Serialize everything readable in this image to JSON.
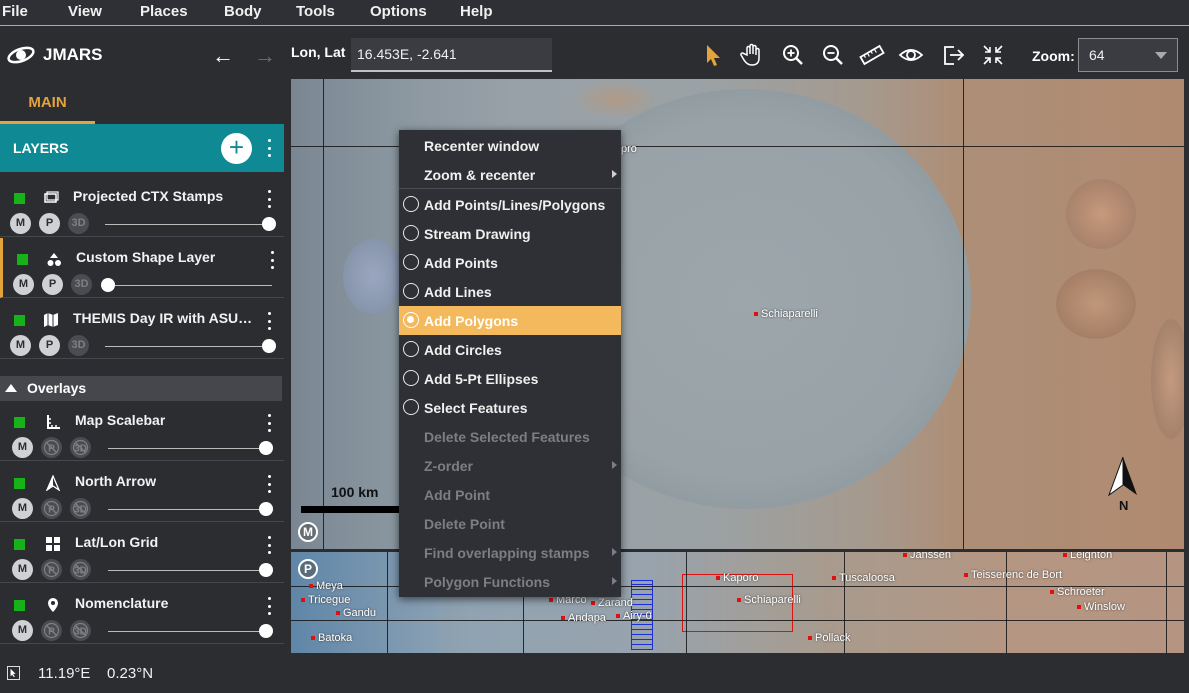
{
  "menubar": [
    "File",
    "View",
    "Places",
    "Body",
    "Tools",
    "Options",
    "Help"
  ],
  "toolbar": {
    "app_name": "JMARS",
    "lonlat_label": "Lon, Lat",
    "lonlat_value": "16.453E, -2.641",
    "zoom_label": "Zoom:",
    "zoom_value": "64",
    "tools": [
      "select-arrow-icon",
      "pan-hand-icon",
      "zoom-in-icon",
      "zoom-out-icon",
      "measure-ruler-icon",
      "view-eye-icon",
      "export-icon",
      "fit-extent-icon"
    ],
    "accent_color": "#e4a33b"
  },
  "left_panel": {
    "tab": "MAIN",
    "layers_title": "LAYERS",
    "layers": [
      {
        "name": "Projected CTX Stamps",
        "icon": "stamp-icon",
        "visible": true,
        "opacity": 1.0,
        "selected": false,
        "mpb": [
          "M",
          "P",
          "3D"
        ]
      },
      {
        "name": "Custom Shape Layer",
        "icon": "shapes-icon",
        "visible": true,
        "opacity": 0.0,
        "selected": true,
        "mpb": [
          "M",
          "P",
          "3D"
        ]
      },
      {
        "name": "THEMIS Day IR with ASU Con...",
        "icon": "map-icon",
        "visible": true,
        "opacity": 1.0,
        "selected": false,
        "mpb": [
          "M",
          "P",
          "3D"
        ]
      }
    ],
    "overlays_title": "Overlays",
    "overlays": [
      {
        "name": "Map Scalebar",
        "icon": "scalebar-icon",
        "visible": true,
        "opacity": 1.0
      },
      {
        "name": "North Arrow",
        "icon": "north-arrow-icon",
        "visible": true,
        "opacity": 1.0
      },
      {
        "name": "Lat/Lon Grid",
        "icon": "grid-icon",
        "visible": true,
        "opacity": 1.0
      },
      {
        "name": "Nomenclature",
        "icon": "pin-icon",
        "visible": true,
        "opacity": 1.0
      }
    ],
    "toggle_labels": {
      "m": "M",
      "p": "P",
      "d": "3D"
    },
    "visible_color": "#17b21a",
    "header_color": "#0f8a95"
  },
  "map": {
    "scalebar_label": "100 km",
    "north_label": "N",
    "badge_main": "M",
    "badge_panner": "P",
    "labels_main": [
      "Schiaparelli",
      "pro"
    ],
    "labels_panner": [
      "Janssen",
      "Leighton",
      "Kaporo",
      "Tuscaloosa",
      "Teisserenc de Bort",
      "Schiaparelli",
      "Schroeter",
      "Winslow",
      "Pollack",
      "Batoka",
      "Marco",
      "Zarand",
      "Andapa",
      "Airy-0",
      "Meya",
      "Tricegue",
      "Gandu"
    ]
  },
  "context_menu": {
    "items": [
      {
        "label": "Recenter window",
        "type": "plain",
        "submenu": false,
        "enabled": true
      },
      {
        "label": "Zoom & recenter",
        "type": "plain",
        "submenu": true,
        "enabled": true
      },
      {
        "label": "Add Points/Lines/Polygons",
        "type": "radio",
        "submenu": false,
        "enabled": true
      },
      {
        "label": "Stream Drawing",
        "type": "radio",
        "submenu": false,
        "enabled": true
      },
      {
        "label": "Add Points",
        "type": "radio",
        "submenu": false,
        "enabled": true
      },
      {
        "label": "Add Lines",
        "type": "radio",
        "submenu": false,
        "enabled": true
      },
      {
        "label": "Add Polygons",
        "type": "radio",
        "submenu": false,
        "enabled": true,
        "active": true
      },
      {
        "label": "Add Circles",
        "type": "radio",
        "submenu": false,
        "enabled": true
      },
      {
        "label": "Add 5-Pt Ellipses",
        "type": "radio",
        "submenu": false,
        "enabled": true
      },
      {
        "label": "Select Features",
        "type": "radio",
        "submenu": false,
        "enabled": true
      },
      {
        "label": "Delete Selected Features",
        "type": "plain",
        "submenu": false,
        "enabled": false
      },
      {
        "label": "Z-order",
        "type": "plain",
        "submenu": true,
        "enabled": false
      },
      {
        "label": "Add Point",
        "type": "plain",
        "submenu": false,
        "enabled": false
      },
      {
        "label": "Delete Point",
        "type": "plain",
        "submenu": false,
        "enabled": false
      },
      {
        "label": "Find overlapping stamps",
        "type": "plain",
        "submenu": true,
        "enabled": false
      },
      {
        "label": "Polygon Functions",
        "type": "plain",
        "submenu": true,
        "enabled": false
      }
    ],
    "active_color": "#f4b95c"
  },
  "status": {
    "lon": "11.19°E",
    "lat": "0.23°N"
  }
}
